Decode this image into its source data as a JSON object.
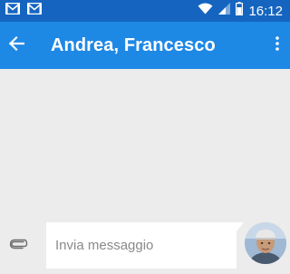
{
  "status_bar": {
    "time": "16:12",
    "left_icons": [
      "gmail-icon",
      "gmail-icon"
    ],
    "right_icons": [
      "wifi-icon",
      "signal-icon",
      "battery-icon"
    ]
  },
  "app_bar": {
    "title": "Andrea, Francesco",
    "back_icon": "arrow-back-icon",
    "menu_icon": "more-vert-icon"
  },
  "composer": {
    "placeholder": "Invia messaggio",
    "value": "",
    "attach_icon": "paperclip-icon"
  },
  "colors": {
    "status_bar": "#1565c0",
    "app_bar": "#1e88e5",
    "background": "#ececec",
    "input_background": "#ffffff"
  }
}
